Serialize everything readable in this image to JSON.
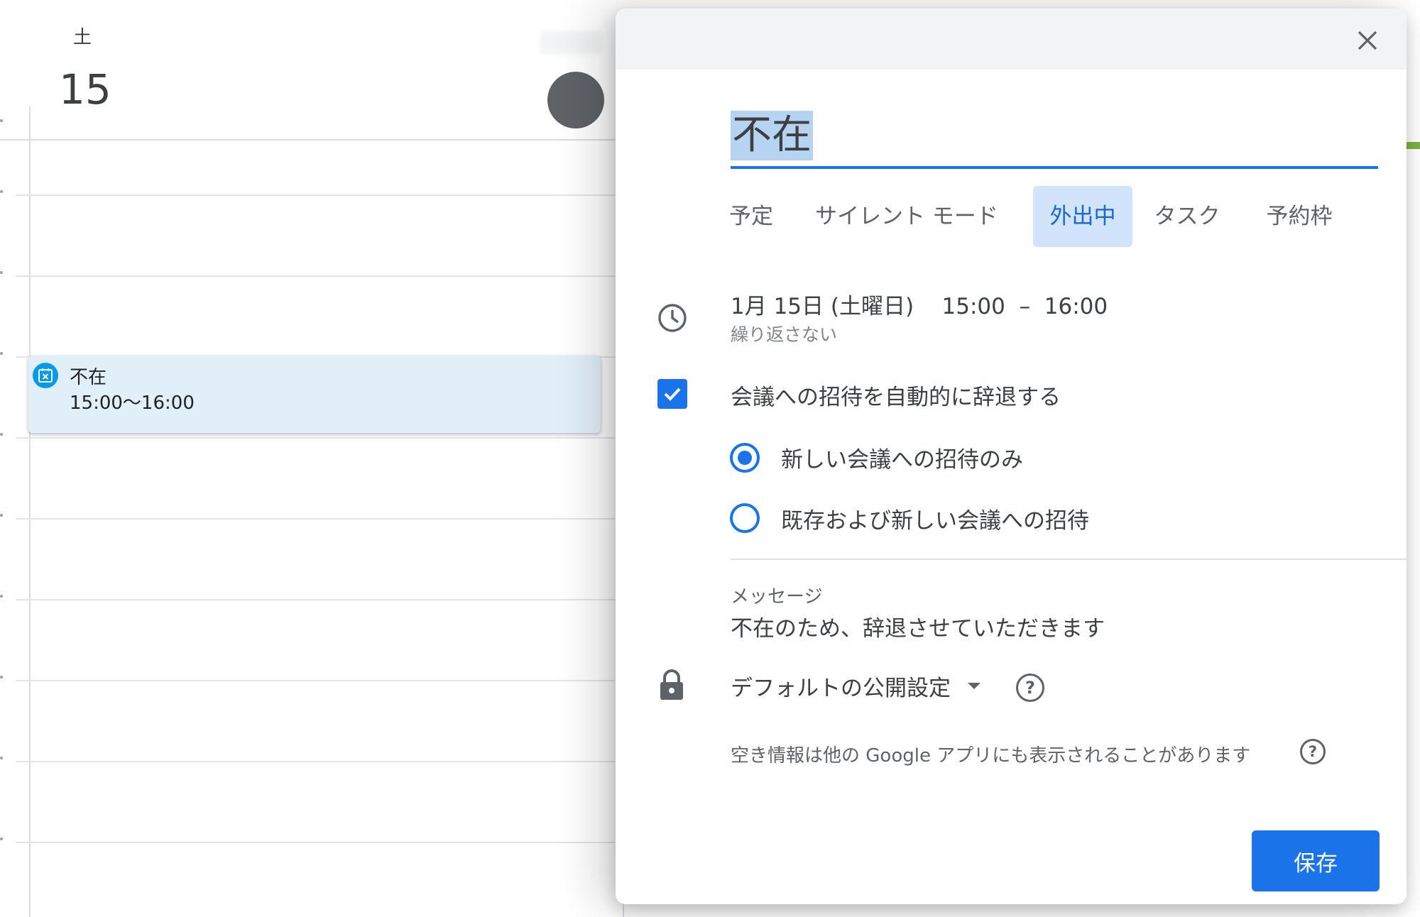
{
  "calendar": {
    "day_name": "土",
    "day_number": "15",
    "event": {
      "title": "不在",
      "time": "15:00〜16:00",
      "icon": "out-of-office-icon"
    }
  },
  "dialog": {
    "title_value": "不在",
    "tabs": [
      {
        "label": "予定",
        "active": false
      },
      {
        "label": "サイレント モード",
        "active": false
      },
      {
        "label": "外出中",
        "active": true
      },
      {
        "label": "タスク",
        "active": false
      },
      {
        "label": "予約枠",
        "active": false
      }
    ],
    "date": "1月 15日 (土曜日)",
    "time_start": "15:00",
    "time_separator": "–",
    "time_end": "16:00",
    "repeat": "繰り返さない",
    "auto_decline": {
      "label": "会議への招待を自動的に辞退する",
      "checked": true
    },
    "decline_options": [
      {
        "label": "新しい会議への招待のみ",
        "selected": true
      },
      {
        "label": "既存および新しい会議への招待",
        "selected": false
      }
    ],
    "message": {
      "label": "メッセージ",
      "text": "不在のため、辞退させていただきます"
    },
    "visibility": {
      "value": "デフォルトの公開設定"
    },
    "availability_info": "空き情報は他の Google アプリにも表示されることがあります",
    "save_label": "保存"
  },
  "colors": {
    "accent": "#1a73e8",
    "active_tab_bg": "#d2e3fc",
    "event_bg": "#e1eff9",
    "event_icon": "#039be5",
    "header_bg": "#f1f3f4"
  }
}
